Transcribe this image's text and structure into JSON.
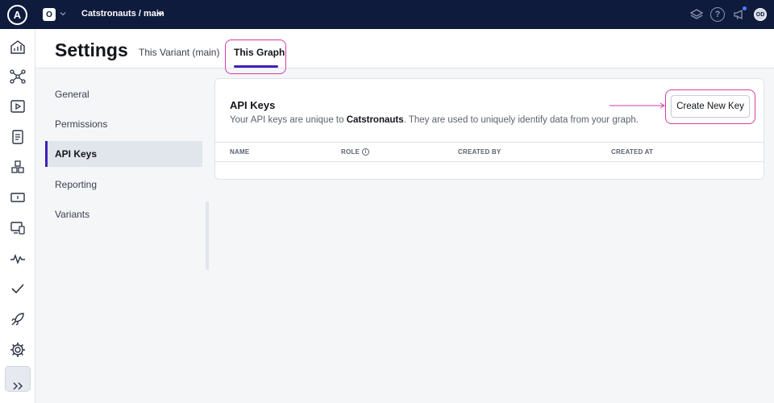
{
  "topbar": {
    "logo_letter": "A",
    "org_letter": "O",
    "graph_name": "Catstronauts / main",
    "help_symbol": "?",
    "avatar_initials": "OD"
  },
  "header": {
    "title": "Settings",
    "tabs": [
      {
        "label": "This Variant (main)",
        "active": false
      },
      {
        "label": "This Graph",
        "active": true
      }
    ]
  },
  "settings_nav": {
    "items": [
      {
        "label": "General"
      },
      {
        "label": "Permissions"
      },
      {
        "label": "API Keys",
        "active": true
      },
      {
        "label": "Reporting"
      },
      {
        "label": "Variants"
      }
    ]
  },
  "api_keys": {
    "title": "API Keys",
    "description_before": "Your API keys are unique to ",
    "graph_name_bold": "Catstronauts",
    "description_after": ". They are used to uniquely identify data from your graph.",
    "create_button": "Create New Key",
    "columns": {
      "name": "NAME",
      "role": "ROLE",
      "created_by": "CREATED BY",
      "created_at": "CREATED AT"
    },
    "role_info_symbol": "i"
  },
  "colors": {
    "topbar_bg": "#0f1b3d",
    "accent": "#3f20ba",
    "highlight": "#d33da6"
  },
  "icons": {
    "rail": [
      "home-chart-icon",
      "schema-graph-icon",
      "explorer-play-icon",
      "checks-document-icon",
      "fields-cubes-icon",
      "changelog-icon",
      "clients-devices-icon",
      "operations-pulse-icon",
      "checks-checkmark-icon",
      "launches-rocket-icon",
      "settings-gear-icon",
      "expand-chevrons-icon"
    ]
  }
}
